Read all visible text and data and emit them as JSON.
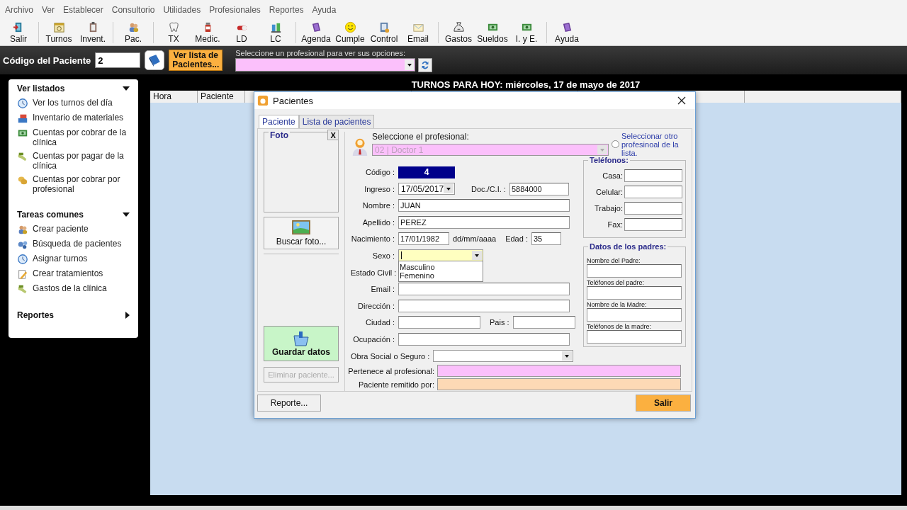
{
  "menu": [
    "Archivo",
    "Ver",
    "Establecer",
    "Consultorio",
    "Utilidades",
    "Profesionales",
    "Reportes",
    "Ayuda"
  ],
  "toolbar": [
    [
      {
        "label": "Salir"
      }
    ],
    [
      {
        "label": "Turnos"
      },
      {
        "label": "Invent."
      }
    ],
    [
      {
        "label": "Pac."
      }
    ],
    [
      {
        "label": "TX"
      },
      {
        "label": "Medic."
      },
      {
        "label": "LD"
      },
      {
        "label": "LC"
      }
    ],
    [
      {
        "label": "Agenda"
      },
      {
        "label": "Cumple"
      },
      {
        "label": "Control"
      },
      {
        "label": "Email"
      }
    ],
    [
      {
        "label": "Gastos"
      },
      {
        "label": "Sueldos"
      },
      {
        "label": "I. y E."
      }
    ],
    [
      {
        "label": "Ayuda"
      }
    ]
  ],
  "patient_bar": {
    "label": "Código del Paciente",
    "code": "2",
    "list_button": "Ver lista de Pacientes...",
    "hint": "Seleccione un profesional para ver sus opciones:"
  },
  "sidebar": [
    {
      "title": "Ver listados",
      "expanded": true,
      "items": [
        "Ver los turnos del día",
        "Inventario de materiales",
        "Cuentas por cobrar de la clínica",
        "Cuentas por pagar de la clínica",
        "Cuentas por cobrar por profesional"
      ]
    },
    {
      "title": "Tareas comunes",
      "expanded": true,
      "items": [
        "Crear paciente",
        "Búsqueda de pacientes",
        "Asignar turnos",
        "Crear tratamientos",
        "Gastos de la clínica"
      ]
    },
    {
      "title": "Reportes",
      "expanded": false
    }
  ],
  "schedule": {
    "title": "TURNOS PARA HOY: miércoles, 17 de mayo de 2017",
    "columns": [
      "Hora",
      "Paciente"
    ]
  },
  "dialog": {
    "title": "Pacientes",
    "tabs": [
      {
        "label": "Paciente",
        "selected": true
      },
      {
        "label": "Lista de pacientes",
        "selected": false
      }
    ],
    "photo": {
      "legend": "Foto",
      "close": "X",
      "button": "Buscar foto..."
    },
    "save_button": "Guardar datos",
    "delete_button": {
      "label": "Eliminar paciente...",
      "disabled": true
    },
    "professional": {
      "label": "Seleccione el profesional:",
      "value": "02 | Doctor 1",
      "disabled": true,
      "other_label": "Seleccionar otro profesinoal de la lista.",
      "other_selected": false
    },
    "codigo": {
      "label": "Código :",
      "value": "4"
    },
    "ingreso": {
      "label": "Ingreso :",
      "value": "17/05/2017"
    },
    "doc": {
      "label": "Doc./C.I. :",
      "value": "5884000"
    },
    "nombre": {
      "label": "Nombre :",
      "value": "JUAN"
    },
    "apellido": {
      "label": "Apellido :",
      "value": "PEREZ"
    },
    "nacimiento": {
      "label": "Nacimiento :",
      "value": "17/01/1982",
      "hint": "dd/mm/aaaa"
    },
    "edad": {
      "label": "Edad :",
      "value": "35"
    },
    "sexo": {
      "label": "Sexo :",
      "expanded": true,
      "options": [
        "Masculino",
        "Femenino"
      ]
    },
    "estado_civil": {
      "label": "Estado Civil :"
    },
    "email": {
      "label": "Email :"
    },
    "direccion": {
      "label": "Dirección :"
    },
    "ciudad": {
      "label": "Ciudad :"
    },
    "pais": {
      "label": "Pais :"
    },
    "ocupacion": {
      "label": "Ocupación :"
    },
    "obra_social": {
      "label": "Obra Social o Seguro :"
    },
    "pertenece": {
      "label": "Pertenece al profesional:"
    },
    "remitido": {
      "label": "Paciente remitido por:"
    },
    "phones": {
      "legend": "Teléfonos:",
      "fields": [
        "Casa:",
        "Celular:",
        "Trabajo:",
        "Fax:"
      ]
    },
    "parents": {
      "legend": "Datos de los padres:",
      "fields": [
        "Nombre del Padre:",
        "Teléfonos del padre:",
        "Nombre de la Madre:",
        "Teléfonos de la madre:"
      ]
    },
    "report_button": "Reporte...",
    "exit_button": "Salir"
  }
}
